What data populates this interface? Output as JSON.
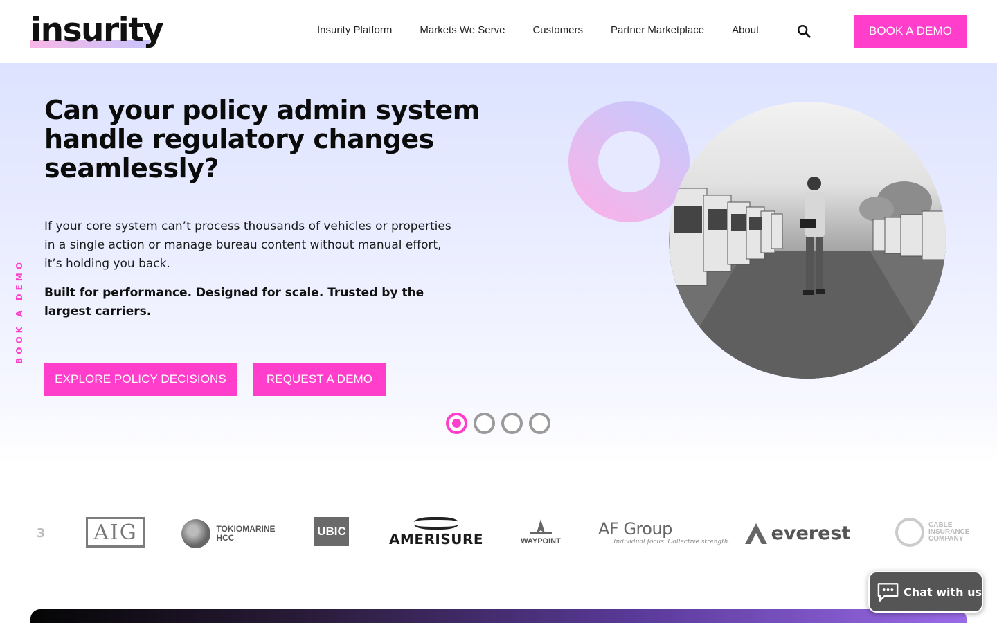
{
  "header": {
    "logo_text": "insurity",
    "nav": [
      "Insurity Platform",
      "Markets We Serve",
      "Customers",
      "Partner Marketplace",
      "About"
    ],
    "cta_label": "BOOK A DEMO"
  },
  "hero": {
    "headline": "Can your policy admin system handle regulatory changes seamlessly?",
    "body": "If your core system can’t process thousands of vehicles or properties in a single action or manage bureau content without manual effort, it’s holding you back.",
    "strong": "Built for performance. Designed for scale. Trusted by the largest carriers.",
    "primary_button": "EXPLORE POLICY DECISIONS",
    "secondary_button": "REQUEST A DEMO",
    "side_tab": "BOOK A DEMO",
    "slide_count": 4,
    "active_slide": 1
  },
  "customer_logos": {
    "aig": "AIG",
    "tokio_line1": "TOKIOMARINE",
    "tokio_line2": "HCC",
    "ubic": "UBIC",
    "amerisure": "AMERISURE",
    "waypoint": "WAYPOINT",
    "afgroup": "AF Group",
    "afgroup_tagline": "Individual focus. Collective strength.",
    "everest": "everest",
    "cable_line1": "CABLE",
    "cable_line2": "INSURANCE",
    "cable_line3": "COMPANY"
  },
  "chat": {
    "label": "Chat with us"
  },
  "colors": {
    "accent": "#ff3fcb",
    "hero_bg": "#dde3ff",
    "chat_bg": "#555555"
  },
  "icons": {
    "search": "search-icon",
    "chat": "chat-bubble-icon"
  }
}
